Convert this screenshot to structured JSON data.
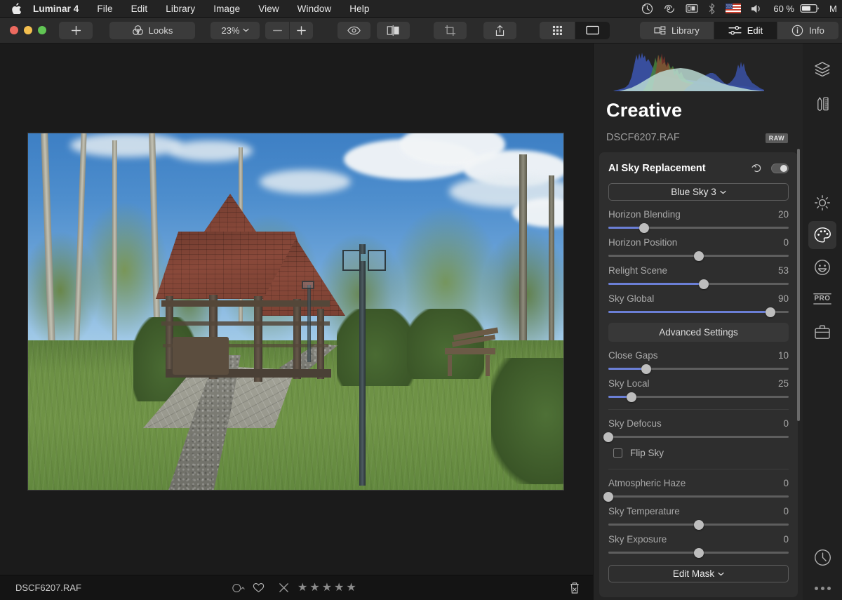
{
  "menubar": {
    "apple_icon": "apple-logo-icon",
    "items": [
      {
        "label": "Luminar 4",
        "bold": true
      },
      {
        "label": "File"
      },
      {
        "label": "Edit"
      },
      {
        "label": "Library"
      },
      {
        "label": "Image"
      },
      {
        "label": "View"
      },
      {
        "label": "Window"
      },
      {
        "label": "Help"
      }
    ],
    "status": {
      "icons": [
        "time-machine-icon",
        "dropbox-icon",
        "display-icon",
        "bluetooth-icon",
        "us-flag-icon",
        "volume-icon"
      ],
      "battery_percent": "60 %",
      "battery_icon": "battery-icon",
      "clock": "M"
    }
  },
  "toolbar": {
    "window_controls": [
      "close-button",
      "minimize-button",
      "zoom-button"
    ],
    "add_label": "+",
    "looks_label": "Looks",
    "zoom_level": "23%",
    "zoom_out_label": "−",
    "zoom_in_label": "+",
    "preview_icon": "eye-icon",
    "compare_icon": "compare-split-icon",
    "crop_icon": "crop-icon",
    "share_icon": "share-icon",
    "grid_view_icon": "grid-view-icon",
    "single_view_icon": "single-view-icon",
    "modes": [
      {
        "label": "Library",
        "icon": "library-icon",
        "active": false
      },
      {
        "label": "Edit",
        "icon": "sliders-icon",
        "active": true
      },
      {
        "label": "Info",
        "icon": "info-icon",
        "active": false
      }
    ]
  },
  "canvas": {
    "photo_alt": "park-gazebo-photo"
  },
  "bottombar": {
    "filename": "DSCF6207.RAF",
    "color_label_icon": "color-label-icon",
    "flag_icon": "heart-icon",
    "reject_icon": "reject-x-icon",
    "stars": [
      "★",
      "★",
      "★",
      "★",
      "★"
    ],
    "trash_icon": "trash-icon"
  },
  "rightpanel": {
    "histogram_name": "rgb-histogram",
    "title": "Creative",
    "filename": "DSCF6207.RAF",
    "raw_badge": "RAW",
    "tool": {
      "name": "AI Sky Replacement",
      "reset_icon": "reset-arrow-icon",
      "toggle_on": true,
      "sky_selector": {
        "value": "Blue Sky 3",
        "chevron": "ˇ"
      },
      "advanced_settings_label": "Advanced Settings",
      "edit_mask_label": "Edit Mask",
      "edit_mask_chevron": "ˇ",
      "flip_sky": {
        "label": "Flip Sky",
        "checked": false
      },
      "sliders": [
        {
          "label": "Horizon Blending",
          "value": "20",
          "pct": 20,
          "bipolar": false
        },
        {
          "label": "Horizon Position",
          "value": "0",
          "pct": 50,
          "bipolar": true
        },
        {
          "label": "Relight Scene",
          "value": "53",
          "pct": 53,
          "bipolar": false
        },
        {
          "label": "Sky Global",
          "value": "90",
          "pct": 90,
          "bipolar": false
        },
        {
          "label": "Close Gaps",
          "value": "10",
          "pct": 21,
          "bipolar": false
        },
        {
          "label": "Sky Local",
          "value": "25",
          "pct": 13,
          "bipolar": false
        },
        {
          "label": "Sky Defocus",
          "value": "0",
          "pct": 0,
          "bipolar": false
        },
        {
          "label": "Atmospheric Haze",
          "value": "0",
          "pct": 0,
          "bipolar": false
        },
        {
          "label": "Sky Temperature",
          "value": "0",
          "pct": 50,
          "bipolar": true
        },
        {
          "label": "Sky Exposure",
          "value": "0",
          "pct": 50,
          "bipolar": true
        }
      ]
    }
  },
  "rail": {
    "top": [
      {
        "name": "layers-icon",
        "active": false
      },
      {
        "name": "canvas-tools-icon",
        "active": false
      }
    ],
    "groups": [
      {
        "name": "essentials-sun-icon",
        "active": false
      },
      {
        "name": "creative-palette-icon",
        "active": true
      },
      {
        "name": "portrait-smiley-icon",
        "active": false
      },
      {
        "name": "pro-icon",
        "label": "PRO",
        "active": false
      },
      {
        "name": "toolkit-briefcase-icon",
        "active": false
      }
    ],
    "bottom": [
      {
        "name": "history-clock-icon"
      },
      {
        "name": "more-dots-icon"
      }
    ]
  },
  "colors": {
    "accent": "#6b7fd6",
    "panel_bg": "#242424",
    "card_bg": "#2e2e2e",
    "toolbar_bg": "#2b2b2b",
    "menubar_bg": "#232323",
    "canvas_bg": "#1b1b1b"
  }
}
